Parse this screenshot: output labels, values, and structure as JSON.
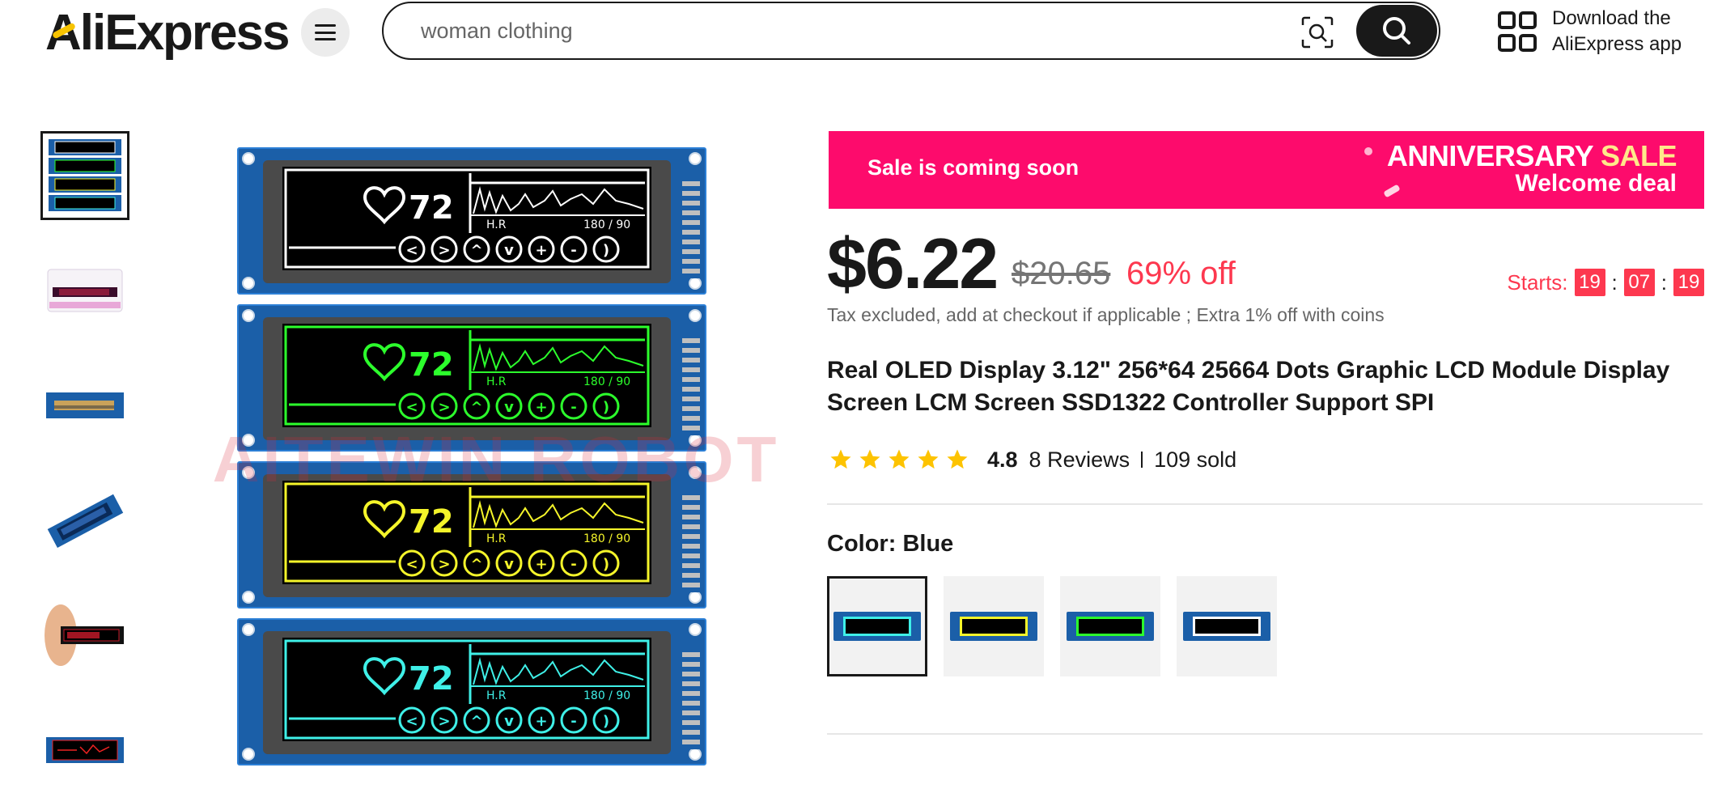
{
  "header": {
    "logo": "AliExpress",
    "search": {
      "value": "",
      "placeholder": "woman clothing"
    },
    "app_download_label": "Download the AliExpress app"
  },
  "gallery": {
    "thumbnails": [
      {
        "label": "thumbnail 1",
        "active": true
      },
      {
        "label": "thumbnail 2",
        "active": false
      },
      {
        "label": "thumbnail 3",
        "active": false
      },
      {
        "label": "thumbnail 4",
        "active": false
      },
      {
        "label": "thumbnail 5",
        "active": false
      },
      {
        "label": "thumbnail 6",
        "active": false
      }
    ],
    "main_image": {
      "watermark": "AITEWIN ROBOT",
      "screen_colors": [
        "#ffffff",
        "#2cff2c",
        "#f5f52a",
        "#3ff0e8"
      ],
      "screen_texts": {
        "heart_value": "72",
        "hr_label": "H.R",
        "bp_label": "180 / 90"
      }
    }
  },
  "promo_banner": {
    "left_text": "Sale is coming soon",
    "anniversary": "ANNIVERSARY",
    "sale": "SALE",
    "welcome": "Welcome deal",
    "background": "#fd0b6c"
  },
  "pricing": {
    "price": "$6.22",
    "original_price": "$20.65",
    "discount": "69% off",
    "tax_note": "Tax excluded, add at checkout if applicable ; Extra 1% off with coins",
    "countdown": {
      "label": "Starts:",
      "hours": "19",
      "minutes": "07",
      "seconds": "19"
    },
    "accent_color": "#fd384f"
  },
  "product": {
    "title": "Real OLED Display 3.12\" 256*64 25664 Dots Graphic LCD Module Display Screen LCM Screen SSD1322 Controller Support SPI",
    "rating": "4.8",
    "reviews": "8 Reviews",
    "sold": "109 sold",
    "star_count": 5,
    "star_color": "#fdc300"
  },
  "color_selector": {
    "label": "Color:",
    "selected": "Blue",
    "options": [
      {
        "name": "Blue",
        "screen_color": "#3ff0e8",
        "active": true
      },
      {
        "name": "Yellow",
        "screen_color": "#f5f52a",
        "active": false
      },
      {
        "name": "Green",
        "screen_color": "#2cff2c",
        "active": false
      },
      {
        "name": "White",
        "screen_color": "#ffffff",
        "active": false
      }
    ]
  }
}
